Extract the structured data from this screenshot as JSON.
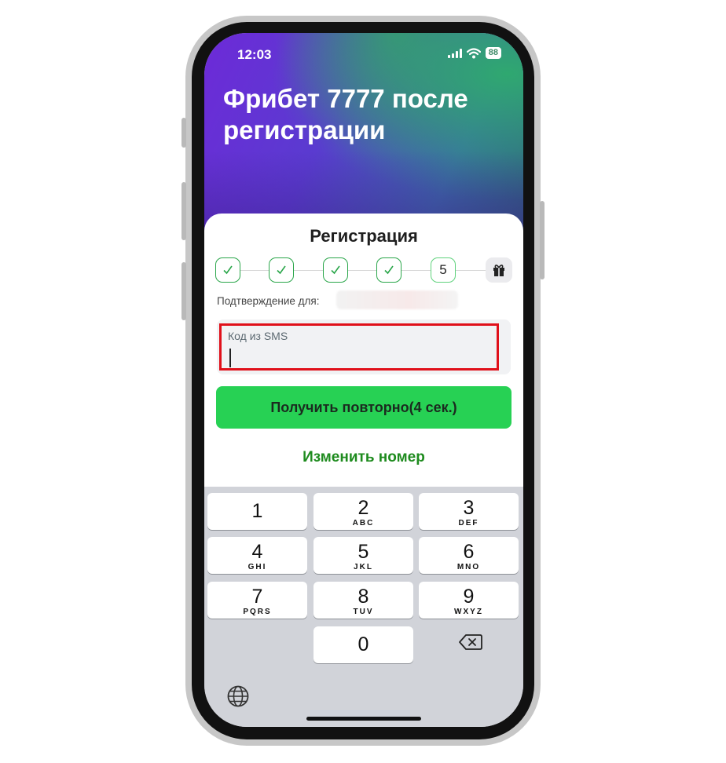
{
  "status_bar": {
    "time": "12:03",
    "battery": "88"
  },
  "hero": {
    "title": "Фрибет 7777 после регистрации"
  },
  "registration": {
    "title": "Регистрация",
    "current_step": "5",
    "confirm_label": "Подтверждение для:",
    "code_field": {
      "label": "Код из SMS",
      "value": ""
    },
    "resend_button": "Получить повторно(4 сек.)",
    "change_number": "Изменить номер"
  },
  "keypad": {
    "keys": [
      {
        "num": "1",
        "letters": ""
      },
      {
        "num": "2",
        "letters": "ABC"
      },
      {
        "num": "3",
        "letters": "DEF"
      },
      {
        "num": "4",
        "letters": "GHI"
      },
      {
        "num": "5",
        "letters": "JKL"
      },
      {
        "num": "6",
        "letters": "MNO"
      },
      {
        "num": "7",
        "letters": "PQRS"
      },
      {
        "num": "8",
        "letters": "TUV"
      },
      {
        "num": "9",
        "letters": "WXYZ"
      },
      {
        "num": "0",
        "letters": ""
      }
    ]
  },
  "colors": {
    "accent_green": "#27d154",
    "link_green": "#1e8b1e",
    "focus_border": "#e0101a"
  }
}
